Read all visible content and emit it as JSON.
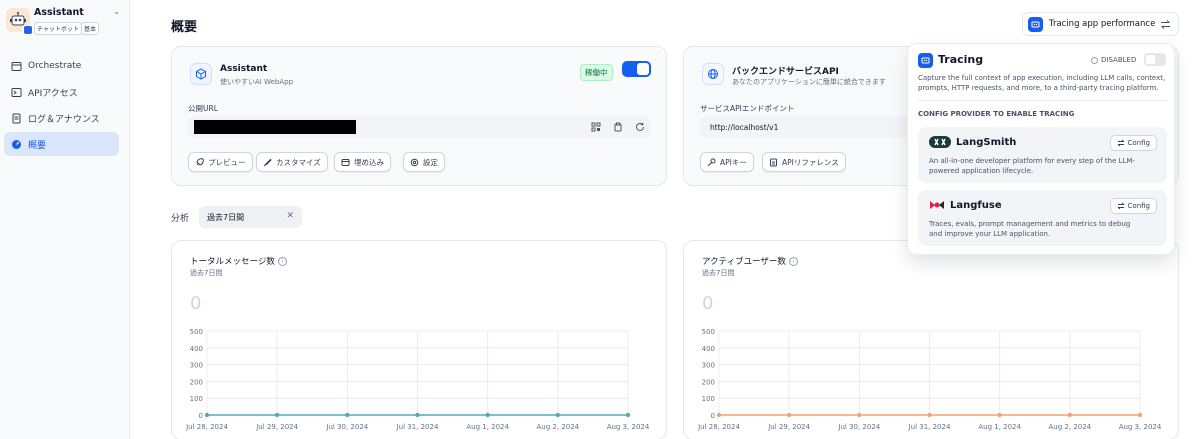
{
  "app": {
    "name": "Assistant",
    "badges": [
      "チャットボット",
      "基本"
    ]
  },
  "sidebar": {
    "items": [
      {
        "label": "Orchestrate",
        "icon": "terminal-square-icon",
        "active": false
      },
      {
        "label": "APIアクセス",
        "icon": "terminal-icon",
        "active": false
      },
      {
        "label": "ログ＆アナウンス",
        "icon": "file-list-icon",
        "active": false
      },
      {
        "label": "概要",
        "icon": "dashboard-icon",
        "active": true
      }
    ]
  },
  "page": {
    "title": "概要"
  },
  "webapp_card": {
    "title": "Assistant",
    "subtitle": "使いやすいAI WebApp",
    "status": "稼働中",
    "enabled": true,
    "url_label": "公開URL",
    "buttons": [
      "プレビュー",
      "カスタマイズ",
      "埋め込み",
      "設定"
    ]
  },
  "api_card": {
    "title": "バックエンドサービスAPI",
    "subtitle": "あなたのアプリケーションに簡単に統合できます",
    "endpoint_label": "サービスAPIエンドポイント",
    "endpoint": "http://localhost/v1",
    "buttons": [
      "APIキー",
      "APIリファレンス"
    ]
  },
  "analysis": {
    "label": "分析",
    "period": "過去7日間"
  },
  "charts": [
    {
      "title": "トータルメッセージ数",
      "subtitle": "過去7日間",
      "total": "0",
      "color": "#56a9b8"
    },
    {
      "title": "アクティブユーザー数",
      "subtitle": "過去7日間",
      "total": "0",
      "color": "#f4a272"
    }
  ],
  "chart_data": [
    {
      "type": "line",
      "title": "トータルメッセージ数",
      "x": [
        "Jul 28, 2024",
        "Jul 29, 2024",
        "Jul 30, 2024",
        "Jul 31, 2024",
        "Aug 1, 2024",
        "Aug 2, 2024",
        "Aug 3, 2024"
      ],
      "series": [
        {
          "values": [
            0,
            0,
            0,
            0,
            0,
            0,
            0
          ]
        }
      ],
      "y_ticks": [
        0,
        100,
        200,
        300,
        400,
        500
      ],
      "ylim": [
        0,
        500
      ],
      "grid": true
    },
    {
      "type": "line",
      "title": "アクティブユーザー数",
      "x": [
        "Jul 28, 2024",
        "Jul 29, 2024",
        "Jul 30, 2024",
        "Jul 31, 2024",
        "Aug 1, 2024",
        "Aug 2, 2024",
        "Aug 3, 2024"
      ],
      "series": [
        {
          "values": [
            0,
            0,
            0,
            0,
            0,
            0,
            0
          ]
        }
      ],
      "y_ticks": [
        0,
        100,
        200,
        300,
        400,
        500
      ],
      "ylim": [
        0,
        500
      ],
      "grid": true
    }
  ],
  "tracing": {
    "pill_label": "Tracing app performance",
    "title": "Tracing",
    "status": "DISABLED",
    "enabled": false,
    "description": "Capture the full context of app execution, including LLM calls, context, prompts, HTTP requests, and more, to a third-party tracing platform.",
    "section_title": "CONFIG PROVIDER TO ENABLE TRACING",
    "providers": [
      {
        "name": "LangSmith",
        "description": "An all-in-one developer platform for every step of the LLM-powered application lifecycle.",
        "button": "Config"
      },
      {
        "name": "Langfuse",
        "description": "Traces, evals, prompt management and metrics to debug and improve your LLM application.",
        "button": "Config"
      }
    ]
  }
}
